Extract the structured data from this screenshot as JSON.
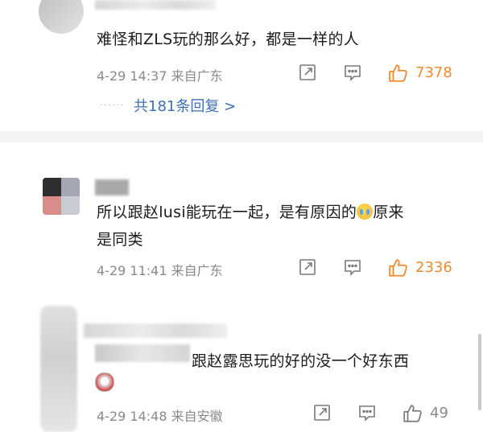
{
  "comments": [
    {
      "text": "难怪和ZLS玩的那么好，都是一样的人",
      "time": "4-29 14:37",
      "location": "来自广东",
      "likes": "7378",
      "reply_link": "共181条回复 >",
      "liked": true
    },
    {
      "text_line1": "所以跟赵lusi能玩在一起，是有原因的",
      "text_line1_after_emoji": "原来",
      "text_line2": "是同类",
      "time": "4-29 11:41",
      "location": "来自广东",
      "likes": "2336",
      "liked": true
    },
    {
      "text": "跟赵露思玩的好的没一个好东西",
      "time": "4-29 14:48",
      "location": "来自安徽",
      "likes": "49",
      "liked": false
    }
  ],
  "colors": {
    "like_active": "#f08a2e",
    "meta_gray": "#8a8a8a",
    "link_blue": "#3d6fb6"
  },
  "icons": {
    "share": "share-icon",
    "comment": "comment-icon",
    "like": "thumbs-up-icon",
    "emoji": "crying-emoji-icon"
  }
}
